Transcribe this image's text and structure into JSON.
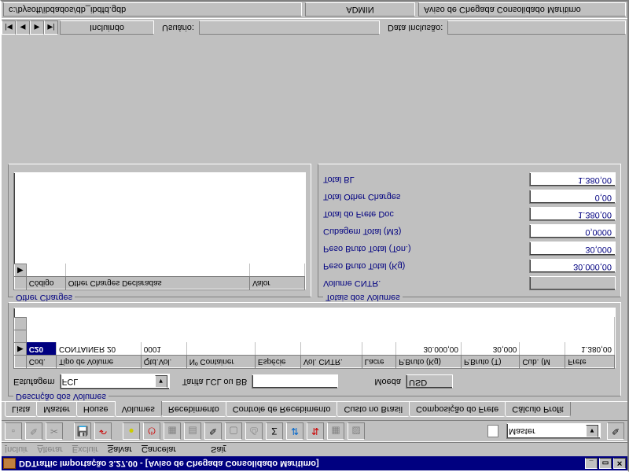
{
  "window": {
    "title": "DDTraffic Importação 3.27.00 - [Aviso de Chegada Consolidado Marítimo]",
    "min": "_",
    "max": "▭",
    "close": "✕"
  },
  "menu": {
    "incluir": "Incluir",
    "alterar": "Alterar",
    "excluir": "Excluir",
    "salvar": "Salvar",
    "cancelar": "Cancelar",
    "sair": "Sair"
  },
  "toolbar": {
    "master": "Master",
    "icons": [
      "📄",
      "📝",
      "✂",
      "💾",
      "↶",
      "●",
      "🖨",
      "🗑",
      "📑",
      "✎",
      "📋",
      "🖨",
      "Σ",
      "⇵",
      "⇅",
      "📊",
      "🗂"
    ]
  },
  "tabs": [
    "Lista",
    "Master",
    "House",
    "Volumes",
    "Recebimento",
    "Controle de Recebimento",
    "Custo no Brasil",
    "Composição do Frete",
    "Cálculo Profit"
  ],
  "active_tab": 3,
  "descricao": {
    "title": "Descrição dos Volumes",
    "estufagem_lbl": "Estufagem",
    "estufagem_val": "FCL",
    "tarifa_lbl": "Tarifa LCL ou BB",
    "tarifa_val": "",
    "moeda_lbl": "Moeda",
    "moeda_val": "USD",
    "cols": [
      "",
      "Cod.",
      "Tipo de Volume",
      "Qtd.Vol.",
      "Nº Container",
      "Espécie",
      "Vol. CNTR.",
      "Lacre",
      "P.Bruto (Kg)",
      "P.Bruto (T)",
      "Cub. (M",
      "Frete"
    ],
    "row": [
      "▶",
      "C20",
      "CONTAINER 20",
      "0001",
      "",
      "",
      "",
      "",
      "30.000,00",
      "30,000",
      "",
      "1.380,00"
    ]
  },
  "othercharges": {
    "title": "Other Charges",
    "cols": [
      "",
      "Código",
      "Other Charges Declaradas",
      "Valor"
    ]
  },
  "totais": {
    "title": "Totais dos Volumes",
    "rows": [
      {
        "label": "Volume CNTR.",
        "value": "",
        "empty": true
      },
      {
        "label": "Peso Bruto Total (Kg)",
        "value": "30.000,00"
      },
      {
        "label": "Peso Bruto Total (Ton.)",
        "value": "30,000"
      },
      {
        "label": "Cubagem Total (M3)",
        "value": "0,0000"
      },
      {
        "label": "Total do Frete Doc",
        "value": "1.380,00"
      },
      {
        "label": "Total Other Charges",
        "value": "0,00"
      },
      {
        "label": "Total BL",
        "value": "1.380,00"
      }
    ]
  },
  "status1": {
    "incluindo": "Incluindo",
    "usuario_lbl": "Usuário:",
    "usuario_val": "",
    "data_lbl": "Data Inclusão:",
    "data_val": ""
  },
  "status2": {
    "path": "c:/bysoft/ibdados/db_ibdfd.gdb",
    "user": "ADMIN",
    "module": "Aviso de Chegada Consolidado Marítimo"
  }
}
